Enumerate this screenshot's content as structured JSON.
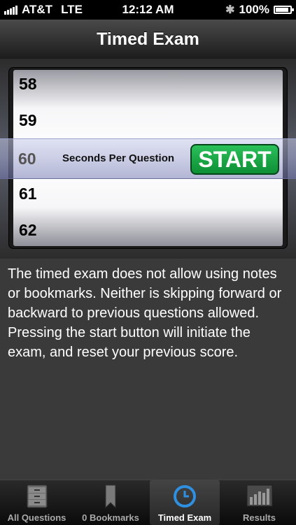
{
  "status_bar": {
    "carrier": "AT&T",
    "network": "LTE",
    "time": "12:12 AM",
    "battery": "100%",
    "battery_level": 1.0
  },
  "nav": {
    "title": "Timed Exam"
  },
  "picker": {
    "rows": [
      "58",
      "59",
      "61",
      "62"
    ],
    "selected": "60",
    "label": "Seconds Per Question"
  },
  "start_button": {
    "label": "START"
  },
  "description": "The timed exam does not allow using notes or bookmarks. Neither is skipping forward or backward to previous questions allowed. Pressing the start button will initiate the exam, and reset your previous score.",
  "tabs": [
    {
      "label": "All Questions",
      "icon": "cabinet-icon"
    },
    {
      "label": "0 Bookmarks",
      "icon": "bookmark-icon"
    },
    {
      "label": "Timed Exam",
      "icon": "clock-icon"
    },
    {
      "label": "Results",
      "icon": "bar-chart-icon"
    }
  ],
  "colors": {
    "start_green": "#1aa847",
    "clock_blue": "#2f8fe0"
  }
}
